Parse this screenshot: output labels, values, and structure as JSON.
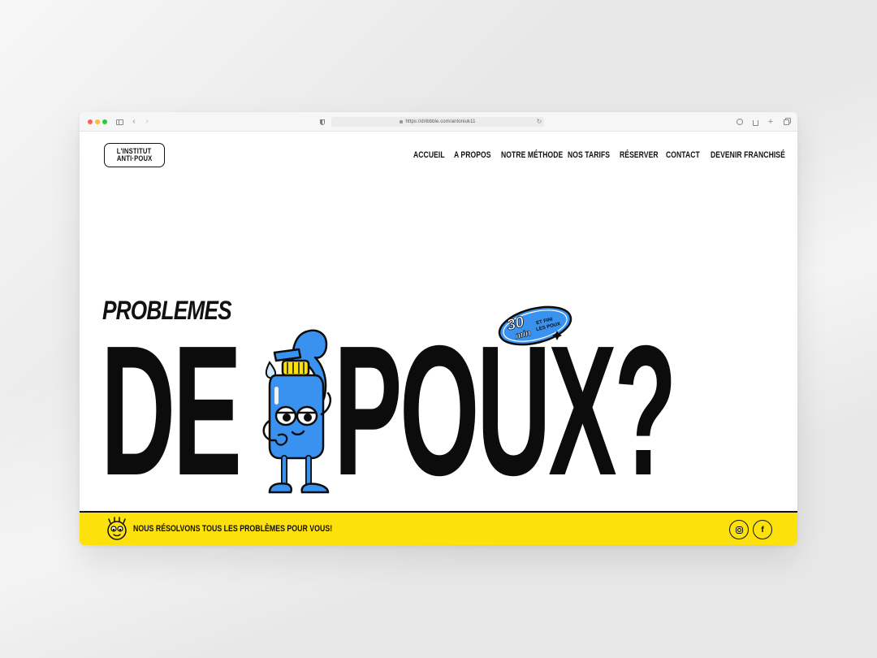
{
  "browser": {
    "url": "https://dribbble.com/antoniuk11",
    "controls": [
      "sidebar-icon",
      "back-icon",
      "forward-icon",
      "shield-icon",
      "reload-icon",
      "download-icon",
      "share-icon",
      "plus-icon",
      "tabs-icon"
    ]
  },
  "header": {
    "logo_line1": "L'INSTITUT",
    "logo_line2": "ANTI·POUX",
    "nav": [
      "ACCUEIL",
      "A PROPOS",
      "NOTRE MÉTHODE",
      "NOS TARIFS",
      "RÉSERVER",
      "CONTACT",
      "DEVENIR FRANCHISÉ"
    ]
  },
  "hero": {
    "subtitle": "PROBLEMES",
    "headline_part1": "DE",
    "headline_part2": "POUX?",
    "badge_number": "30",
    "badge_unit": "min",
    "badge_text_line1": "ET FINI",
    "badge_text_line2": "LES POUX"
  },
  "footer": {
    "tagline": "NOUS RÉSOLVONS TOUS LES PROBLÈMES POUR VOUS!",
    "social": [
      "instagram-icon",
      "facebook-icon"
    ],
    "facebook_glyph": "f"
  },
  "colors": {
    "accent_yellow": "#fde10a",
    "mascot_blue": "#3a92f0",
    "text_black": "#0c0c0c",
    "background": "#ffffff"
  }
}
